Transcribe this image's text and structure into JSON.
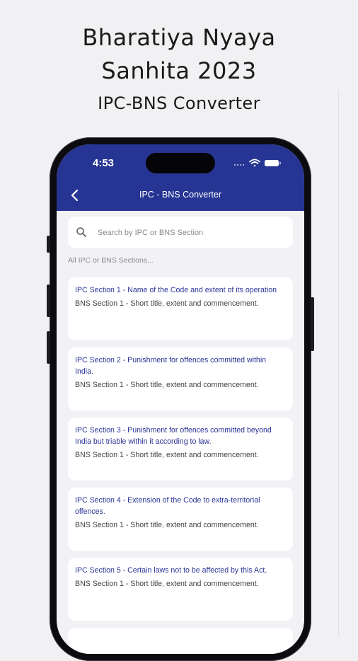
{
  "promo": {
    "title_line1": "Bharatiya  Nyaya",
    "title_line2": "Sanhita 2023",
    "subtitle": "IPC-BNS Converter"
  },
  "status_bar": {
    "time": "4:53",
    "signal": "....",
    "wifi_icon": "wifi-icon",
    "battery_icon": "battery-icon"
  },
  "app_bar": {
    "title": "IPC - BNS Converter",
    "back_icon": "chevron-left-icon",
    "color": "#263593"
  },
  "search": {
    "placeholder": "Search by IPC or BNS Section",
    "value": "",
    "icon": "search-icon"
  },
  "list_label": "All IPC or BNS Sections...",
  "sections": [
    {
      "ipc": "IPC Section 1 - Name of the Code and extent of its operation",
      "bns": "BNS Section 1 - Short title, extent and commencement."
    },
    {
      "ipc": "IPC Section 2 - Punishment for offences committed within India.",
      "bns": "BNS Section 1 - Short title, extent and commencement."
    },
    {
      "ipc": "IPC Section 3 - Punishment for offences committed beyond India but triable within it according to law.",
      "bns": "BNS Section 1 - Short title, extent and commencement."
    },
    {
      "ipc": "IPC Section 4 - Extension of the Code to extra-territorial offences.",
      "bns": "BNS Section 1 - Short title, extent and commencement."
    },
    {
      "ipc": "IPC Section 5 - Certain laws not to be affected by this Act.",
      "bns": "BNS Section 1 - Short title, extent and commencement."
    }
  ],
  "colors": {
    "ipc_text": "#2a3596",
    "bns_text": "#444444",
    "background": "#f1f1f3"
  }
}
